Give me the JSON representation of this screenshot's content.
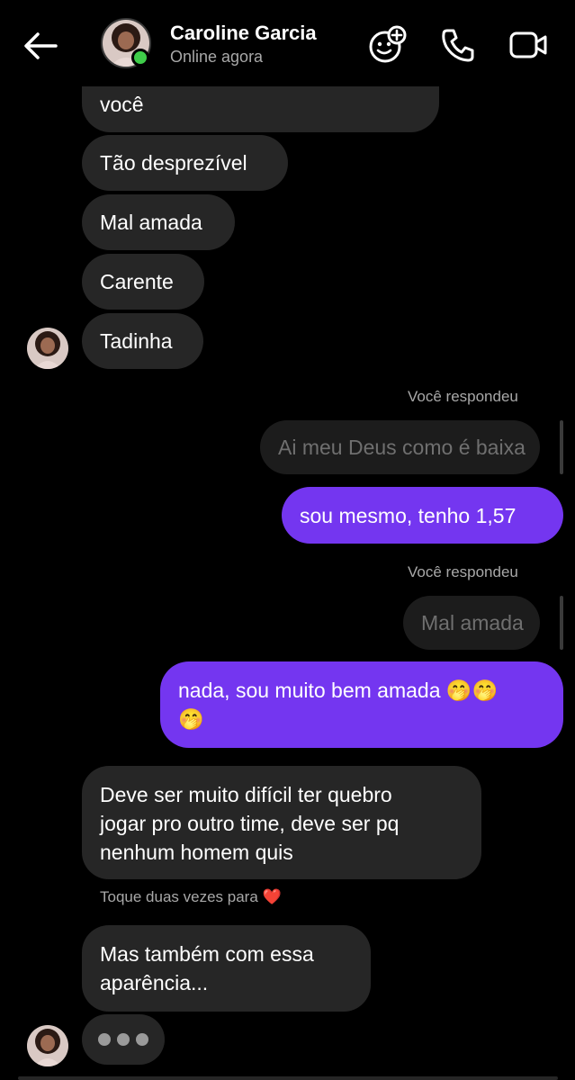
{
  "header": {
    "contact_name": "Caroline Garcia",
    "status": "Online agora",
    "icons": [
      "back-arrow-icon",
      "avatar-sticker-icon",
      "phone-icon",
      "video-camera-icon"
    ],
    "online_color": "#3fcd4a"
  },
  "messages": {
    "partial_top": "você",
    "in_1": "Tão desprezível",
    "in_2": "Mal amada",
    "in_3": "Carente",
    "in_4": "Tadinha",
    "reply_label_1": "Você respondeu",
    "quoted_1": "Ai meu Deus como é baixa",
    "out_1": "sou mesmo, tenho 1,57",
    "reply_label_2": "Você respondeu",
    "quoted_2": "Mal amada",
    "out_2_line1": "nada, sou muito bem amada 🤭🤭",
    "out_2_line2": "🤭",
    "in_5_line1": "Deve ser muito difícil ter quebro",
    "in_5_line2": "jogar pro outro time, deve ser pq",
    "in_5_line3": "nenhum homem quis",
    "hint": "Toque duas vezes para",
    "hint_heart": "❤️",
    "in_6_line1": "Mas também com essa",
    "in_6_line2": "aparência..."
  },
  "colors": {
    "incoming_bubble": "#262626",
    "outgoing_bubble": "#7436f0",
    "background": "#000000"
  }
}
